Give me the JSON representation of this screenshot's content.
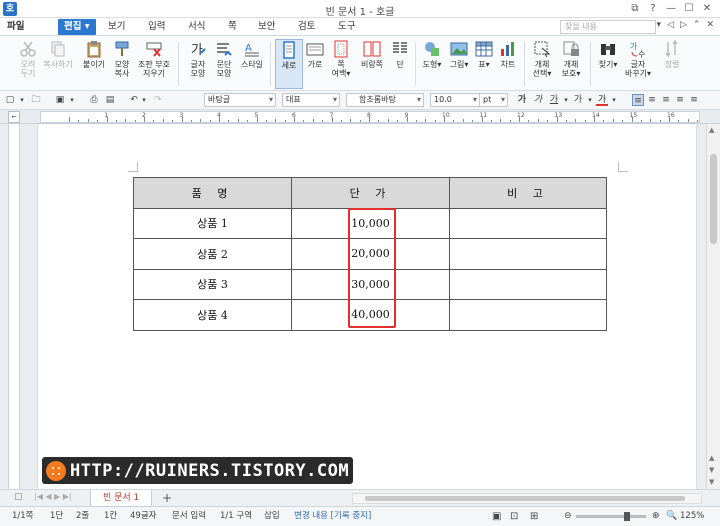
{
  "window": {
    "title": "빈 문서 1 - 호글",
    "app_icon": "호"
  },
  "menubar": {
    "file": "파일",
    "edit": "편집",
    "items": [
      "보기",
      "입력",
      "서식",
      "쪽",
      "보안",
      "검토",
      "도구"
    ],
    "search_placeholder": "찾을 내용"
  },
  "ribbon": {
    "cut": "오려\n두기",
    "copy": "복사하기",
    "paste": "붙이기",
    "shape_copy": [
      "모양",
      "복사"
    ],
    "clear_format": [
      "조판 부호",
      "지우기"
    ],
    "char_shape": [
      "글자",
      "모양"
    ],
    "para_shape": [
      "문단",
      "모양"
    ],
    "style": "스타일",
    "portrait": "세로",
    "landscape": "가로",
    "page_margin": [
      "쪽",
      "여백"
    ],
    "wide_page": "비랑쪽",
    "columns": "단",
    "shapes": "도형",
    "picture": "그림",
    "table": "표",
    "chart": "차트",
    "select_object": [
      "개체",
      "선택"
    ],
    "protect_object": [
      "개체",
      "보호"
    ],
    "find": "찾기",
    "replace": [
      "글자",
      "바꾸기"
    ],
    "align": "정렬"
  },
  "formatbar": {
    "style_name": "바탕글",
    "lang": "대표",
    "font": "함초롬바탕",
    "size": "10.0",
    "unit": "pt"
  },
  "ruler_numbers": [
    "1",
    "2",
    "3",
    "4",
    "5",
    "6",
    "7",
    "8",
    "9",
    "10",
    "11",
    "12",
    "13",
    "14",
    "15",
    "16"
  ],
  "table": {
    "headers": [
      "품 명",
      "단 가",
      "비 고"
    ],
    "rows": [
      [
        "상품 1",
        "10,000",
        ""
      ],
      [
        "상품 2",
        "20,000",
        ""
      ],
      [
        "상품 3",
        "30,000",
        ""
      ],
      [
        "상품 4",
        "40,000",
        ""
      ]
    ]
  },
  "watermark": "HTTP://RUINERS.TISTORY.COM",
  "tabs": {
    "doc_tab": "빈 문서 1"
  },
  "statusbar": {
    "page": "1/1쪽",
    "column": "1단",
    "line": "2줄",
    "col": "1칸",
    "chars": "49글자",
    "mode": "문서 입력",
    "section": "1/1 구역",
    "insert": "삽입",
    "track": "변경 내용 [기록 중지]",
    "zoom": "125%"
  },
  "colors": {
    "accent": "#2b78d1",
    "highlight_box": "#e03030",
    "header_fill": "#d9d9d9"
  }
}
